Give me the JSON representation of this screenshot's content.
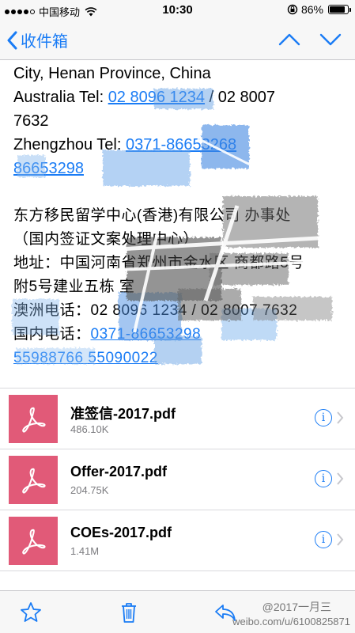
{
  "status_bar": {
    "carrier": "中国移动",
    "time": "10:30",
    "battery_percent": "86%",
    "battery_level": 0.86
  },
  "nav": {
    "back_label": "收件箱"
  },
  "body": {
    "line1": "City, Henan Province, China",
    "line2_prefix": "Australia Tel: ",
    "line2_link": "02 8096 1234",
    "line2_suffix": " / 02 8007",
    "line3": "7632",
    "line4_prefix": "Zhengzhou Tel: ",
    "line4_link": "0371-86653268",
    "line5_link": "86653298",
    "line6": "东方移民留学中心(香港)有限公司 办事处",
    "line7": "（国内签证文案处理中心）",
    "line8": "地址：中国河南省郑州市金水区 商都路5号",
    "line9": "附5号建业五栋 室",
    "line10_prefix": "澳洲电话：02 8096 1234",
    "line10_suffix": " / 02 8007 7632",
    "line11_prefix": "国内电话：",
    "line11_link": "0371-86653298",
    "line12_link": "55988766 55090022"
  },
  "attachments": [
    {
      "name": "准签信-2017.pdf",
      "size": "486.10K"
    },
    {
      "name": "Offer-2017.pdf",
      "size": "204.75K"
    },
    {
      "name": "COEs-2017.pdf",
      "size": "1.41M"
    }
  ],
  "toolbar": {
    "watermark_top": "@2017一月三",
    "watermark_bottom": "weibo.com/u/6100825871"
  },
  "icons": {
    "info": "i",
    "accent": "#1a7cf5",
    "pdf_bg": "#e15a78"
  }
}
